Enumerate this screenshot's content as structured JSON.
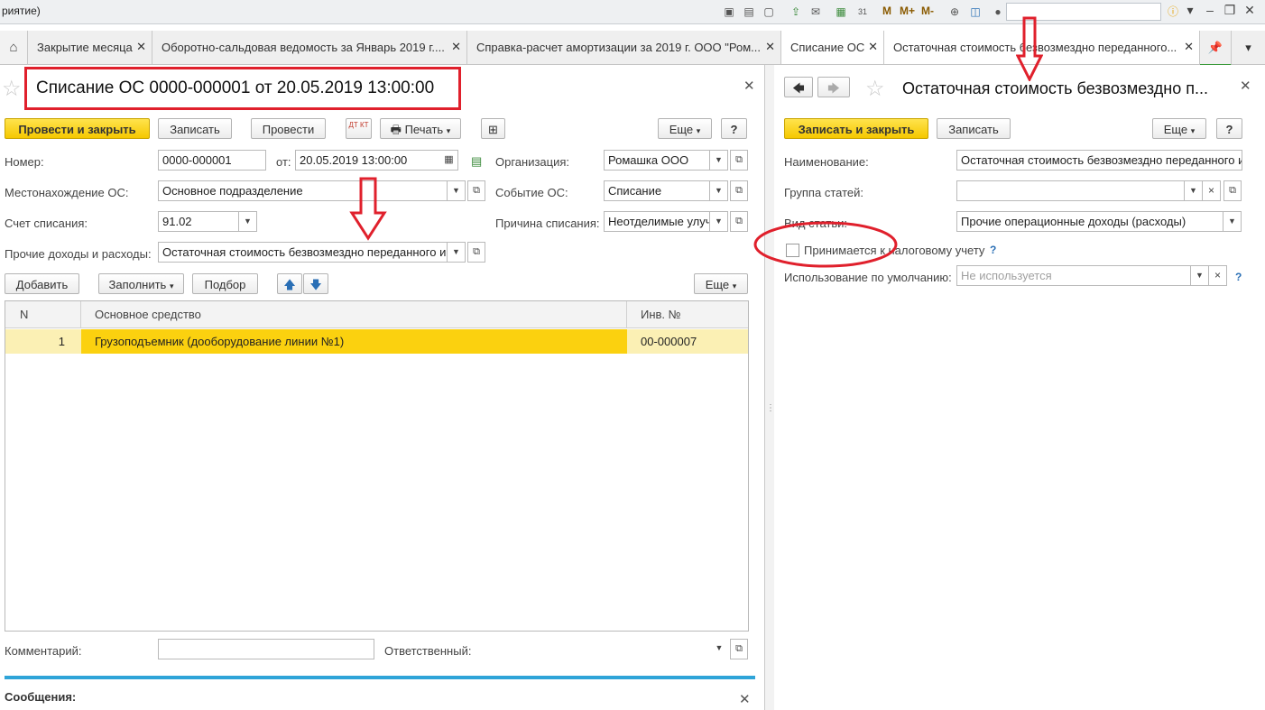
{
  "window": {
    "title_fragment": "риятие)"
  },
  "toolbar": {
    "m": "M",
    "m_plus": "M+",
    "m_minus": "M-",
    "calendar_day": "31"
  },
  "tabs": [
    {
      "label": "Закрытие месяца"
    },
    {
      "label": "Оборотно-сальдовая ведомость за Январь 2019 г...."
    },
    {
      "label": "Справка-расчет амортизации за 2019 г. ООО \"Ром..."
    },
    {
      "label": "Списание ОС"
    },
    {
      "label": "Остаточная стоимость безвозмездно переданного..."
    }
  ],
  "left_form": {
    "title": "Списание ОС 0000-000001 от 20.05.2019 13:00:00",
    "buttons": {
      "post_close": "Провести и закрыть",
      "save": "Записать",
      "post": "Провести",
      "dtkt": "ДТ КТ",
      "print": "Печать",
      "more": "Еще",
      "help": "?"
    },
    "fields": {
      "number_label": "Номер:",
      "number": "0000-000001",
      "from_label": "от:",
      "date": "20.05.2019 13:00:00",
      "org_label": "Организация:",
      "org": "Ромашка ООО",
      "location_label": "Местонахождение ОС:",
      "location": "Основное подразделение",
      "event_label": "Событие ОС:",
      "event": "Списание",
      "account_label": "Счет списания:",
      "account": "91.02",
      "reason_label": "Причина списания:",
      "reason": "Неотделимые улуч",
      "other_label": "Прочие доходы и расходы:",
      "other": "Остаточная стоимость безвозмездно переданного им"
    },
    "table_toolbar": {
      "add": "Добавить",
      "fill": "Заполнить",
      "select": "Подбор",
      "more": "Еще"
    },
    "table": {
      "headers": {
        "n": "N",
        "asset": "Основное средство",
        "inv": "Инв. №"
      },
      "rows": [
        {
          "n": "1",
          "asset": "Грузоподъемник (дооборудование линии №1)",
          "inv": "00-000007"
        }
      ]
    },
    "comment_label": "Комментарий:",
    "responsible_label": "Ответственный:",
    "messages_label": "Сообщения:"
  },
  "right_form": {
    "title": "Остаточная стоимость безвозмездно п...",
    "buttons": {
      "save_close": "Записать и закрыть",
      "save": "Записать",
      "more": "Еще",
      "help": "?"
    },
    "fields": {
      "name_label": "Наименование:",
      "name": "Остаточная стоимость безвозмездно переданного и",
      "group_label": "Группа статей:",
      "group": "",
      "type_label": "Вид статьи:",
      "type": "Прочие операционные доходы (расходы)",
      "tax_checkbox_label": "Принимается к налоговому учету",
      "tax_help": "?",
      "default_label": "Использование по умолчанию:",
      "default_placeholder": "Не используется",
      "default_help": "?"
    }
  },
  "colors": {
    "accent_yellow": "#f5c800",
    "row_highlight": "#fbf0b4",
    "annotation_red": "#e0202c",
    "messages_bar": "#2fa4d8"
  }
}
